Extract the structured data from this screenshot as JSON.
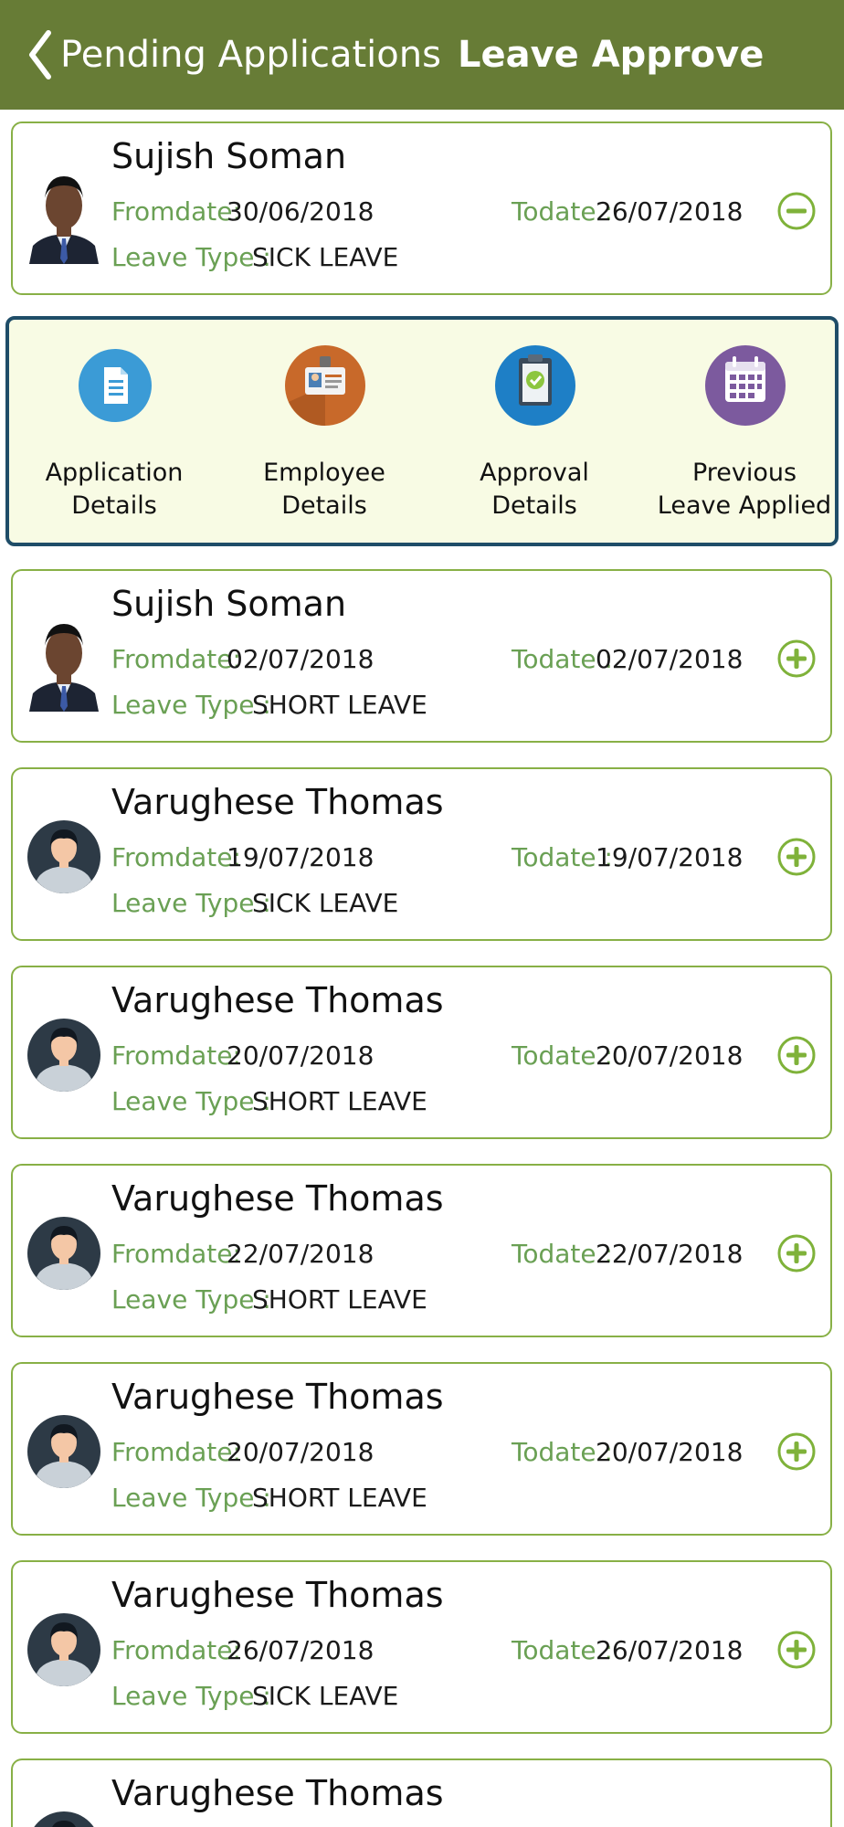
{
  "header": {
    "back_label": "Pending Applications",
    "title": "Leave Approve"
  },
  "labels": {
    "fromdate": "Fromdate:",
    "todate": "Todate :",
    "leave_type": "Leave Type :"
  },
  "actions": [
    {
      "line1": "Application",
      "line2": "Details",
      "icon": "document-icon",
      "color": "#3b9bd6"
    },
    {
      "line1": "Employee",
      "line2": "Details",
      "icon": "id-card-icon",
      "color": "#c8692a"
    },
    {
      "line1": "Approval",
      "line2": "Details",
      "icon": "clipboard-check-icon",
      "color": "#1e7fc6"
    },
    {
      "line1": "Previous",
      "line2": "Leave Applied",
      "icon": "calendar-icon",
      "color": "#7c5a9e"
    }
  ],
  "applications": [
    {
      "name": "Sujish Soman",
      "fromdate": "30/06/2018",
      "todate": "26/07/2018",
      "leave_type": "SICK LEAVE",
      "avatar": "photo",
      "expanded": true
    },
    {
      "name": "Sujish Soman",
      "fromdate": "02/07/2018",
      "todate": "02/07/2018",
      "leave_type": "SHORT LEAVE",
      "avatar": "photo",
      "expanded": false
    },
    {
      "name": "Varughese Thomas",
      "fromdate": "19/07/2018",
      "todate": "19/07/2018",
      "leave_type": "SICK LEAVE",
      "avatar": "placeholder",
      "expanded": false
    },
    {
      "name": "Varughese Thomas",
      "fromdate": "20/07/2018",
      "todate": "20/07/2018",
      "leave_type": "SHORT LEAVE",
      "avatar": "placeholder",
      "expanded": false
    },
    {
      "name": "Varughese Thomas",
      "fromdate": "22/07/2018",
      "todate": "22/07/2018",
      "leave_type": "SHORT LEAVE",
      "avatar": "placeholder",
      "expanded": false
    },
    {
      "name": "Varughese Thomas",
      "fromdate": "20/07/2018",
      "todate": "20/07/2018",
      "leave_type": "SHORT LEAVE",
      "avatar": "placeholder",
      "expanded": false
    },
    {
      "name": "Varughese Thomas",
      "fromdate": "26/07/2018",
      "todate": "26/07/2018",
      "leave_type": "SICK LEAVE",
      "avatar": "placeholder",
      "expanded": false
    },
    {
      "name": "Varughese Thomas",
      "fromdate": "",
      "todate": "",
      "leave_type": "",
      "avatar": "placeholder",
      "expanded": false
    }
  ],
  "colors": {
    "header_bg": "#677c36",
    "card_border": "#88b046",
    "label_green": "#6aa054",
    "panel_bg": "#f8fbe4",
    "panel_border": "#1f4d68"
  }
}
